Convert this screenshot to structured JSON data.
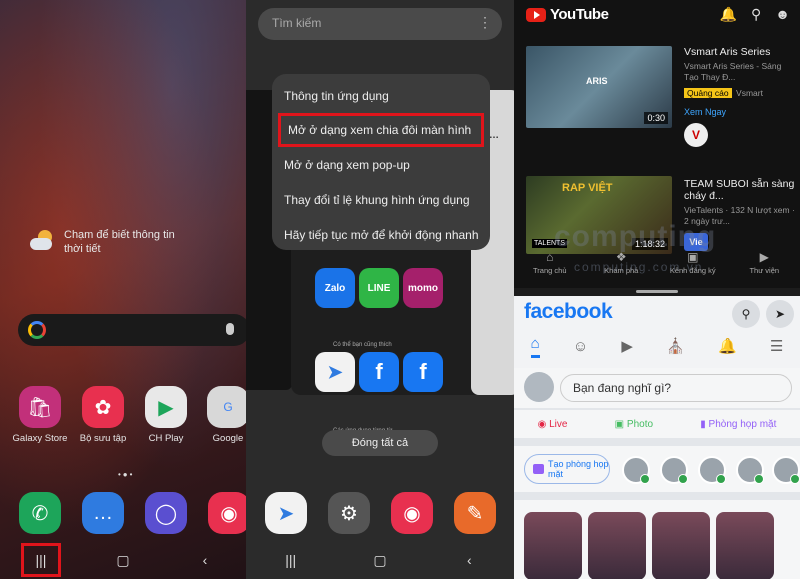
{
  "home": {
    "weather_text": "Chạm để biết thông tin thời tiết",
    "apps": [
      {
        "label": "Galaxy Store",
        "icon": "bag-icon",
        "color": "#c2307a"
      },
      {
        "label": "Bộ sưu tập",
        "icon": "flower-icon",
        "color": "#e8304f"
      },
      {
        "label": "CH Play",
        "icon": "play-store-icon",
        "color": "#e8e8e8"
      },
      {
        "label": "Google",
        "icon": "google-folder-icon",
        "color": "#d8d8d8"
      }
    ],
    "dock": [
      {
        "icon": "phone-icon",
        "color": "#1da55a"
      },
      {
        "icon": "messages-icon",
        "color": "#2f7be0"
      },
      {
        "icon": "browser-icon",
        "color": "#5a4fd0"
      },
      {
        "icon": "camera-icon",
        "color": "#e8304f"
      }
    ]
  },
  "recents": {
    "search_placeholder": "Tìm kiếm",
    "menu": [
      "Thông tin ứng dụng",
      "Mở ở dạng xem chia đôi màn hình",
      "Mở ở dạng xem pop-up",
      "Thay đổi tỉ lệ khung hình ứng dụng",
      "Hãy tiếp tục mở để khởi động nhanh"
    ],
    "suggest_label": "Có thể bạn cũng thích",
    "recent_label": "Các ứng dụng từng từ",
    "mini_apps": [
      "Zalo",
      "LINE",
      "momo"
    ],
    "close_all": "Đóng tất cả",
    "dock": [
      {
        "icon": "messenger-icon",
        "color": "#f2f2f2"
      },
      {
        "icon": "settings-icon",
        "color": "#555555"
      },
      {
        "icon": "camera-icon",
        "color": "#e8304f"
      },
      {
        "icon": "notes-icon",
        "color": "#e86a2a"
      }
    ]
  },
  "youtube": {
    "logo_text": "YouTube",
    "video1": {
      "title": "Vsmart Aris Series",
      "subtitle": "Vsmart Aris Series - Sáng Tạo Thay Đ...",
      "ad_badge": "Quảng cáo",
      "advertiser": "Vsmart",
      "cta": "Xem Ngay",
      "duration": "0:30",
      "thumb_brand": "ARIS"
    },
    "video2": {
      "title": "TEAM SUBOI sẵn sàng cháy đ...",
      "subtitle": "VieTalents · 132 N lượt xem · 2 ngày trư...",
      "duration": "1:18:32",
      "thumb_text": "RAP VIỆT",
      "badge": "TALENTS",
      "channel_logo": "Vie"
    },
    "nav": [
      "Trang chủ",
      "Khám phá",
      "Kênh đăng ký",
      "Thư viện"
    ]
  },
  "facebook": {
    "logo_text": "facebook",
    "composer_placeholder": "Bạn đang nghĩ gì?",
    "actions": [
      "Live",
      "Photo",
      "Phòng họp mặt"
    ],
    "create_room": "Tạo phòng họp mặt"
  },
  "watermark": "computing",
  "watermark_sub": "computing.com.vn",
  "colors": {
    "highlight": "#e0141b",
    "fb_blue": "#1877f2",
    "yt_red": "#e62117"
  }
}
